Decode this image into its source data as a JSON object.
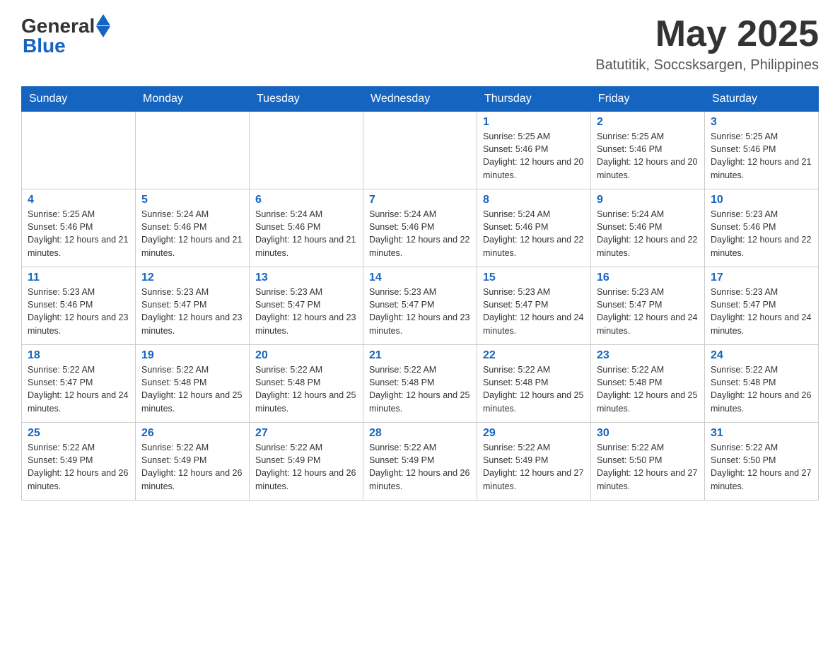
{
  "header": {
    "logo_general": "General",
    "logo_blue": "Blue",
    "month_year": "May 2025",
    "location": "Batutitik, Soccsksargen, Philippines"
  },
  "weekdays": [
    "Sunday",
    "Monday",
    "Tuesday",
    "Wednesday",
    "Thursday",
    "Friday",
    "Saturday"
  ],
  "weeks": [
    [
      {
        "day": "",
        "info": ""
      },
      {
        "day": "",
        "info": ""
      },
      {
        "day": "",
        "info": ""
      },
      {
        "day": "",
        "info": ""
      },
      {
        "day": "1",
        "info": "Sunrise: 5:25 AM\nSunset: 5:46 PM\nDaylight: 12 hours and 20 minutes."
      },
      {
        "day": "2",
        "info": "Sunrise: 5:25 AM\nSunset: 5:46 PM\nDaylight: 12 hours and 20 minutes."
      },
      {
        "day": "3",
        "info": "Sunrise: 5:25 AM\nSunset: 5:46 PM\nDaylight: 12 hours and 21 minutes."
      }
    ],
    [
      {
        "day": "4",
        "info": "Sunrise: 5:25 AM\nSunset: 5:46 PM\nDaylight: 12 hours and 21 minutes."
      },
      {
        "day": "5",
        "info": "Sunrise: 5:24 AM\nSunset: 5:46 PM\nDaylight: 12 hours and 21 minutes."
      },
      {
        "day": "6",
        "info": "Sunrise: 5:24 AM\nSunset: 5:46 PM\nDaylight: 12 hours and 21 minutes."
      },
      {
        "day": "7",
        "info": "Sunrise: 5:24 AM\nSunset: 5:46 PM\nDaylight: 12 hours and 22 minutes."
      },
      {
        "day": "8",
        "info": "Sunrise: 5:24 AM\nSunset: 5:46 PM\nDaylight: 12 hours and 22 minutes."
      },
      {
        "day": "9",
        "info": "Sunrise: 5:24 AM\nSunset: 5:46 PM\nDaylight: 12 hours and 22 minutes."
      },
      {
        "day": "10",
        "info": "Sunrise: 5:23 AM\nSunset: 5:46 PM\nDaylight: 12 hours and 22 minutes."
      }
    ],
    [
      {
        "day": "11",
        "info": "Sunrise: 5:23 AM\nSunset: 5:46 PM\nDaylight: 12 hours and 23 minutes."
      },
      {
        "day": "12",
        "info": "Sunrise: 5:23 AM\nSunset: 5:47 PM\nDaylight: 12 hours and 23 minutes."
      },
      {
        "day": "13",
        "info": "Sunrise: 5:23 AM\nSunset: 5:47 PM\nDaylight: 12 hours and 23 minutes."
      },
      {
        "day": "14",
        "info": "Sunrise: 5:23 AM\nSunset: 5:47 PM\nDaylight: 12 hours and 23 minutes."
      },
      {
        "day": "15",
        "info": "Sunrise: 5:23 AM\nSunset: 5:47 PM\nDaylight: 12 hours and 24 minutes."
      },
      {
        "day": "16",
        "info": "Sunrise: 5:23 AM\nSunset: 5:47 PM\nDaylight: 12 hours and 24 minutes."
      },
      {
        "day": "17",
        "info": "Sunrise: 5:23 AM\nSunset: 5:47 PM\nDaylight: 12 hours and 24 minutes."
      }
    ],
    [
      {
        "day": "18",
        "info": "Sunrise: 5:22 AM\nSunset: 5:47 PM\nDaylight: 12 hours and 24 minutes."
      },
      {
        "day": "19",
        "info": "Sunrise: 5:22 AM\nSunset: 5:48 PM\nDaylight: 12 hours and 25 minutes."
      },
      {
        "day": "20",
        "info": "Sunrise: 5:22 AM\nSunset: 5:48 PM\nDaylight: 12 hours and 25 minutes."
      },
      {
        "day": "21",
        "info": "Sunrise: 5:22 AM\nSunset: 5:48 PM\nDaylight: 12 hours and 25 minutes."
      },
      {
        "day": "22",
        "info": "Sunrise: 5:22 AM\nSunset: 5:48 PM\nDaylight: 12 hours and 25 minutes."
      },
      {
        "day": "23",
        "info": "Sunrise: 5:22 AM\nSunset: 5:48 PM\nDaylight: 12 hours and 25 minutes."
      },
      {
        "day": "24",
        "info": "Sunrise: 5:22 AM\nSunset: 5:48 PM\nDaylight: 12 hours and 26 minutes."
      }
    ],
    [
      {
        "day": "25",
        "info": "Sunrise: 5:22 AM\nSunset: 5:49 PM\nDaylight: 12 hours and 26 minutes."
      },
      {
        "day": "26",
        "info": "Sunrise: 5:22 AM\nSunset: 5:49 PM\nDaylight: 12 hours and 26 minutes."
      },
      {
        "day": "27",
        "info": "Sunrise: 5:22 AM\nSunset: 5:49 PM\nDaylight: 12 hours and 26 minutes."
      },
      {
        "day": "28",
        "info": "Sunrise: 5:22 AM\nSunset: 5:49 PM\nDaylight: 12 hours and 26 minutes."
      },
      {
        "day": "29",
        "info": "Sunrise: 5:22 AM\nSunset: 5:49 PM\nDaylight: 12 hours and 27 minutes."
      },
      {
        "day": "30",
        "info": "Sunrise: 5:22 AM\nSunset: 5:50 PM\nDaylight: 12 hours and 27 minutes."
      },
      {
        "day": "31",
        "info": "Sunrise: 5:22 AM\nSunset: 5:50 PM\nDaylight: 12 hours and 27 minutes."
      }
    ]
  ]
}
